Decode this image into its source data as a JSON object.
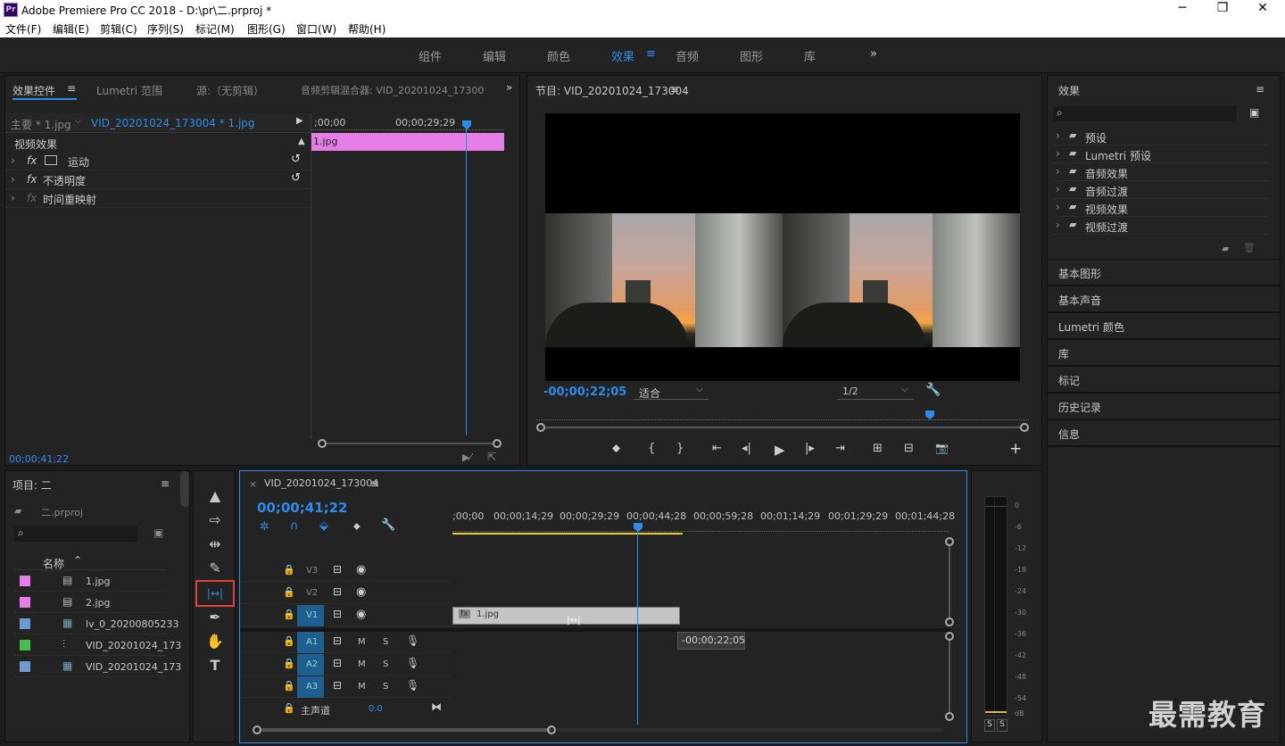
{
  "window": {
    "icon": "Pr",
    "title": "Adobe Premiere Pro CC 2018 - D:\\pr\\二.prproj *",
    "minimize": "─",
    "maximize": "❐",
    "close": "✕"
  },
  "menu": [
    "文件(F)",
    "编辑(E)",
    "剪辑(C)",
    "序列(S)",
    "标记(M)",
    "图形(G)",
    "窗口(W)",
    "帮助(H)"
  ],
  "workspaces": {
    "items": [
      "组件",
      "编辑",
      "颜色",
      "效果",
      "音频",
      "图形",
      "库"
    ],
    "active": "效果",
    "menu_icon": "≡",
    "more_icon": "»"
  },
  "effect_controls": {
    "tabs": [
      "效果控件",
      "Lumetri 范围",
      "源:（无剪辑）",
      "音频剪辑混合器: VID_20201024_17300"
    ],
    "tab_menu": "≡",
    "more": "»",
    "master_clip": "主要 * 1.jpg",
    "sequence_clip": "VID_20201024_173004 * 1.jpg",
    "ruler_start": ";00;00",
    "ruler_mid": "00;00;29;29",
    "clip_label": "1.jpg",
    "section": "视频效果",
    "effects": [
      {
        "fx": "fx",
        "name": "运动",
        "reset": "↺"
      },
      {
        "fx": "fx",
        "name": "不透明度",
        "reset": "↺"
      },
      {
        "fx": "fx",
        "name": "时间重映射",
        "reset": ""
      }
    ],
    "timecode": "00;00;41;22"
  },
  "program": {
    "title": "节目: VID_20201024_173004",
    "menu": "≡",
    "timecode": "-00;00;22;05",
    "fit": "适合",
    "resolution": "1/2",
    "controls": [
      "⬥",
      "{",
      "}",
      "⇤",
      "◂|",
      "▶",
      "|▸",
      "⇥",
      "⊞",
      "⊟",
      "📷"
    ],
    "add": "+"
  },
  "effects_panel": {
    "title": "效果",
    "menu": "≡",
    "tree": [
      "预设",
      "Lumetri 预设",
      "音频效果",
      "音频过渡",
      "视频效果",
      "视频过渡"
    ],
    "sections": [
      "基本图形",
      "基本声音",
      "Lumetri 颜色",
      "库",
      "标记",
      "历史记录",
      "信息"
    ]
  },
  "project": {
    "title": "项目: 二",
    "menu": "≡",
    "file": "二.prproj",
    "column": "名称",
    "items": [
      {
        "name": "1.jpg",
        "color": "#e57ee5"
      },
      {
        "name": "2.jpg",
        "color": "#e57ee5"
      },
      {
        "name": "lv_0_20200805233",
        "color": "#6d9bd1"
      },
      {
        "name": "VID_20201024_173",
        "color": "#4bbd4b"
      },
      {
        "name": "VID_20201024_173",
        "color": "#6d9bd1"
      }
    ]
  },
  "tools": {
    "selection": "▲",
    "track_select": "⇨",
    "ripple": "⇹",
    "razor": "✎",
    "slip": "|↔|",
    "pen": "✒",
    "hand": "✋",
    "type": "T"
  },
  "timeline": {
    "close": "×",
    "title": "VID_20201024_173004",
    "menu": "≡",
    "timecode": "00;00;41;22",
    "ruler": [
      ";00;00",
      "00;00;14;29",
      "00;00;29;29",
      "00;00;44;28",
      "00;00;59;28",
      "00;01;14;29",
      "00;01;29;29",
      "00;01;44;28"
    ],
    "video_tracks": [
      "V3",
      "V2",
      "V1"
    ],
    "audio_tracks": [
      "A1",
      "A2",
      "A3"
    ],
    "master": "主声道",
    "master_value": "0.0",
    "clip": "1.jpg",
    "clip_fx": "fx",
    "tooltip": "-00;00;22;05",
    "m": "M",
    "s": "S"
  },
  "audio_meter": {
    "scale": [
      "0",
      "-6",
      "-12",
      "-18",
      "-24",
      "-30",
      "-36",
      "-42",
      "-48",
      "-54",
      "dB"
    ],
    "solo": [
      "S",
      "S"
    ]
  },
  "watermark": "最需教育",
  "colors": {
    "accent": "#2d8ceb",
    "clip_pink": "#e57ee5",
    "highlight": "#e2403a"
  }
}
